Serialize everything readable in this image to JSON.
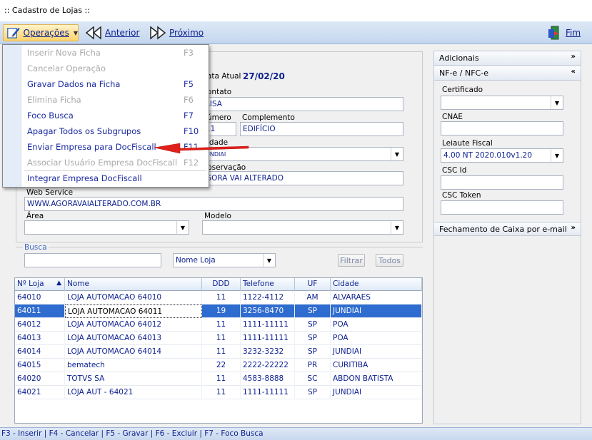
{
  "window": {
    "title": ":: Cadastro de Lojas ::"
  },
  "toolbar": {
    "operacoes": "Operações",
    "anterior": "Anterior",
    "proximo": "Próximo",
    "fim": "Fim"
  },
  "menu": {
    "items": [
      {
        "label": "Inserir Nova Ficha",
        "key": "F3",
        "enabled": false
      },
      {
        "label": "Cancelar Operação",
        "key": "",
        "enabled": false
      },
      {
        "label": "Gravar Dados na Ficha",
        "key": "F5",
        "enabled": true
      },
      {
        "label": "Elimina Ficha",
        "key": "F6",
        "enabled": false
      },
      {
        "label": "Foco Busca",
        "key": "F7",
        "enabled": true
      },
      {
        "label": "Apagar Todos os Subgrupos",
        "key": "F10",
        "enabled": true
      },
      {
        "label": "Enviar Empresa para DocFiscall",
        "key": "F11",
        "enabled": true
      },
      {
        "label": "Associar Usuário Empresa DocFiscall",
        "key": "F12",
        "enabled": false
      },
      {
        "label": "Integrar Empresa DocFiscall",
        "key": "",
        "enabled": true
      }
    ]
  },
  "form": {
    "data_atual_label": "ata Atual",
    "data_atual_value": "27/02/20",
    "contato_label": "ontato",
    "contato_value": "LISA",
    "numero_label": "úmero",
    "numero_value": "11",
    "complemento_label": "Complemento",
    "complemento_value": "EDIFÍCIO",
    "cidade_label": "idade",
    "cidade_value": "UNDIAI",
    "observacao_label": "bservação",
    "observacao_value": "GORA VAI ALTERADO",
    "web_service_label": "Web Service",
    "web_service_value": "WWW.AGORAVAIALTERADO.COM.BR",
    "area_label": "Área",
    "area_value": "",
    "modelo_label": "Modelo",
    "modelo_value": ""
  },
  "busca": {
    "label": "Busca",
    "value": "",
    "field": "Nome Loja",
    "filtrar": "Filtrar",
    "todos": "Todos"
  },
  "grid": {
    "headers": [
      "Nº Loja",
      "Nome",
      "DDD",
      "Telefone",
      "UF",
      "Cidade"
    ],
    "sort_indicator": "▲",
    "rows": [
      {
        "loja": "64010",
        "nome": "LOJA AUTOMACAO 64010",
        "ddd": "11",
        "telefone": "1122-4112",
        "uf": "AM",
        "cidade": "ALVARAES"
      },
      {
        "loja": "64011",
        "nome": "LOJA AUTOMACAO 64011",
        "ddd": "19",
        "telefone": "3256-8470",
        "uf": "SP",
        "cidade": "JUNDIAI"
      },
      {
        "loja": "64012",
        "nome": "LOJA AUTOMACAO 64012",
        "ddd": "11",
        "telefone": "1111-11111",
        "uf": "SP",
        "cidade": "POA"
      },
      {
        "loja": "64013",
        "nome": "LOJA AUTOMACAO 64013",
        "ddd": "11",
        "telefone": "1111-11111",
        "uf": "SP",
        "cidade": "POA"
      },
      {
        "loja": "64014",
        "nome": "LOJA AUTOMACAO 64014",
        "ddd": "11",
        "telefone": "3232-3232",
        "uf": "SP",
        "cidade": "JUNDIAI"
      },
      {
        "loja": "64015",
        "nome": "bematech",
        "ddd": "22",
        "telefone": "2222-22222",
        "uf": "PR",
        "cidade": "CURITIBA"
      },
      {
        "loja": "64020",
        "nome": "TOTVS SA",
        "ddd": "11",
        "telefone": "4583-8888",
        "uf": "SC",
        "cidade": "ABDON BATISTA"
      },
      {
        "loja": "64021",
        "nome": "LOJA AUT - 64021",
        "ddd": "11",
        "telefone": "1111-11111",
        "uf": "SP",
        "cidade": "JUNDIAI"
      }
    ],
    "selected_index": 1
  },
  "right_panel": {
    "adicionais": "Adicionais",
    "nfe": "NF-e / NFC-e",
    "certificado_label": "Certificado",
    "certificado_value": "",
    "cnae_label": "CNAE",
    "cnae_value": "",
    "leiaute_label": "Leiaute Fiscal",
    "leiaute_value": "4.00 NT 2020.010v1.20",
    "csc_id_label": "CSC Id",
    "csc_id_value": "",
    "csc_token_label": "CSC Token",
    "csc_token_value": "",
    "fechamento": "Fechamento de Caixa por e-mail"
  },
  "statusbar": {
    "text": "F3 - Inserir   |   F4 - Cancelar   |   F5 - Gravar   |   F6 - Excluir   |   F7 - Foco Busca"
  },
  "colors": {
    "accent": "#2f6ccf",
    "text_blue": "#0b1f8f",
    "arrow": "#e0201b"
  }
}
